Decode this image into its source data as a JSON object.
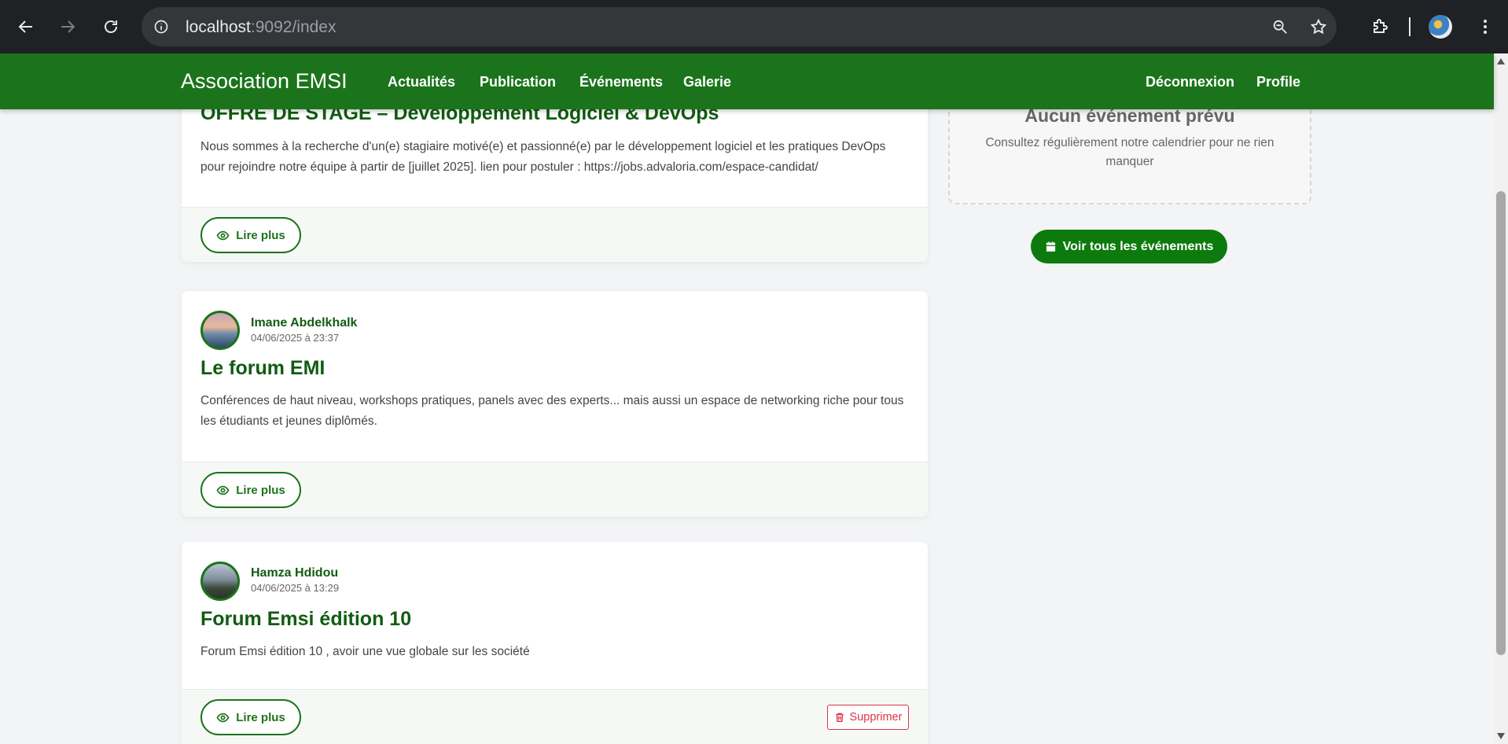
{
  "browser": {
    "url_host": "localhost",
    "url_rest": ":9092/index"
  },
  "navbar": {
    "brand": "Association EMSI",
    "links": [
      "Actualités",
      "Publication",
      "Événements",
      "Galerie"
    ],
    "right_links": [
      "Déconnexion",
      "Profile"
    ],
    "color": "#1b741b"
  },
  "posts": [
    {
      "title": "OFFRE DE STAGE – Développement Logiciel & DevOps",
      "text": "Nous sommes à la recherche d'un(e) stagiaire motivé(e) et passionné(e) par le développement logiciel et les pratiques DevOps pour rejoindre notre équipe à partir de [juillet 2025]. lien pour postuler : https://jobs.advaloria.com/espace-candidat/",
      "read_more": "Lire plus"
    },
    {
      "author": "Imane Abdelkhalk",
      "date": "04/06/2025 à 23:37",
      "title": "Le forum EMI",
      "text": "Conférences de haut niveau, workshops pratiques, panels avec des experts... mais aussi un espace de networking riche pour tous les étudiants et jeunes diplômés.",
      "read_more": "Lire plus"
    },
    {
      "author": "Hamza Hdidou",
      "date": "04/06/2025 à 13:29",
      "title": "Forum Emsi édition 10",
      "text": "Forum Emsi édition 10 , avoir une vue globale sur les société",
      "read_more": "Lire plus",
      "delete": "Supprimer"
    }
  ],
  "sidebar": {
    "empty_title": "Aucun événement prévu",
    "empty_text": "Consultez régulièrement notre calendrier pour ne rien manquer",
    "all_events": "Voir tous les événements"
  }
}
